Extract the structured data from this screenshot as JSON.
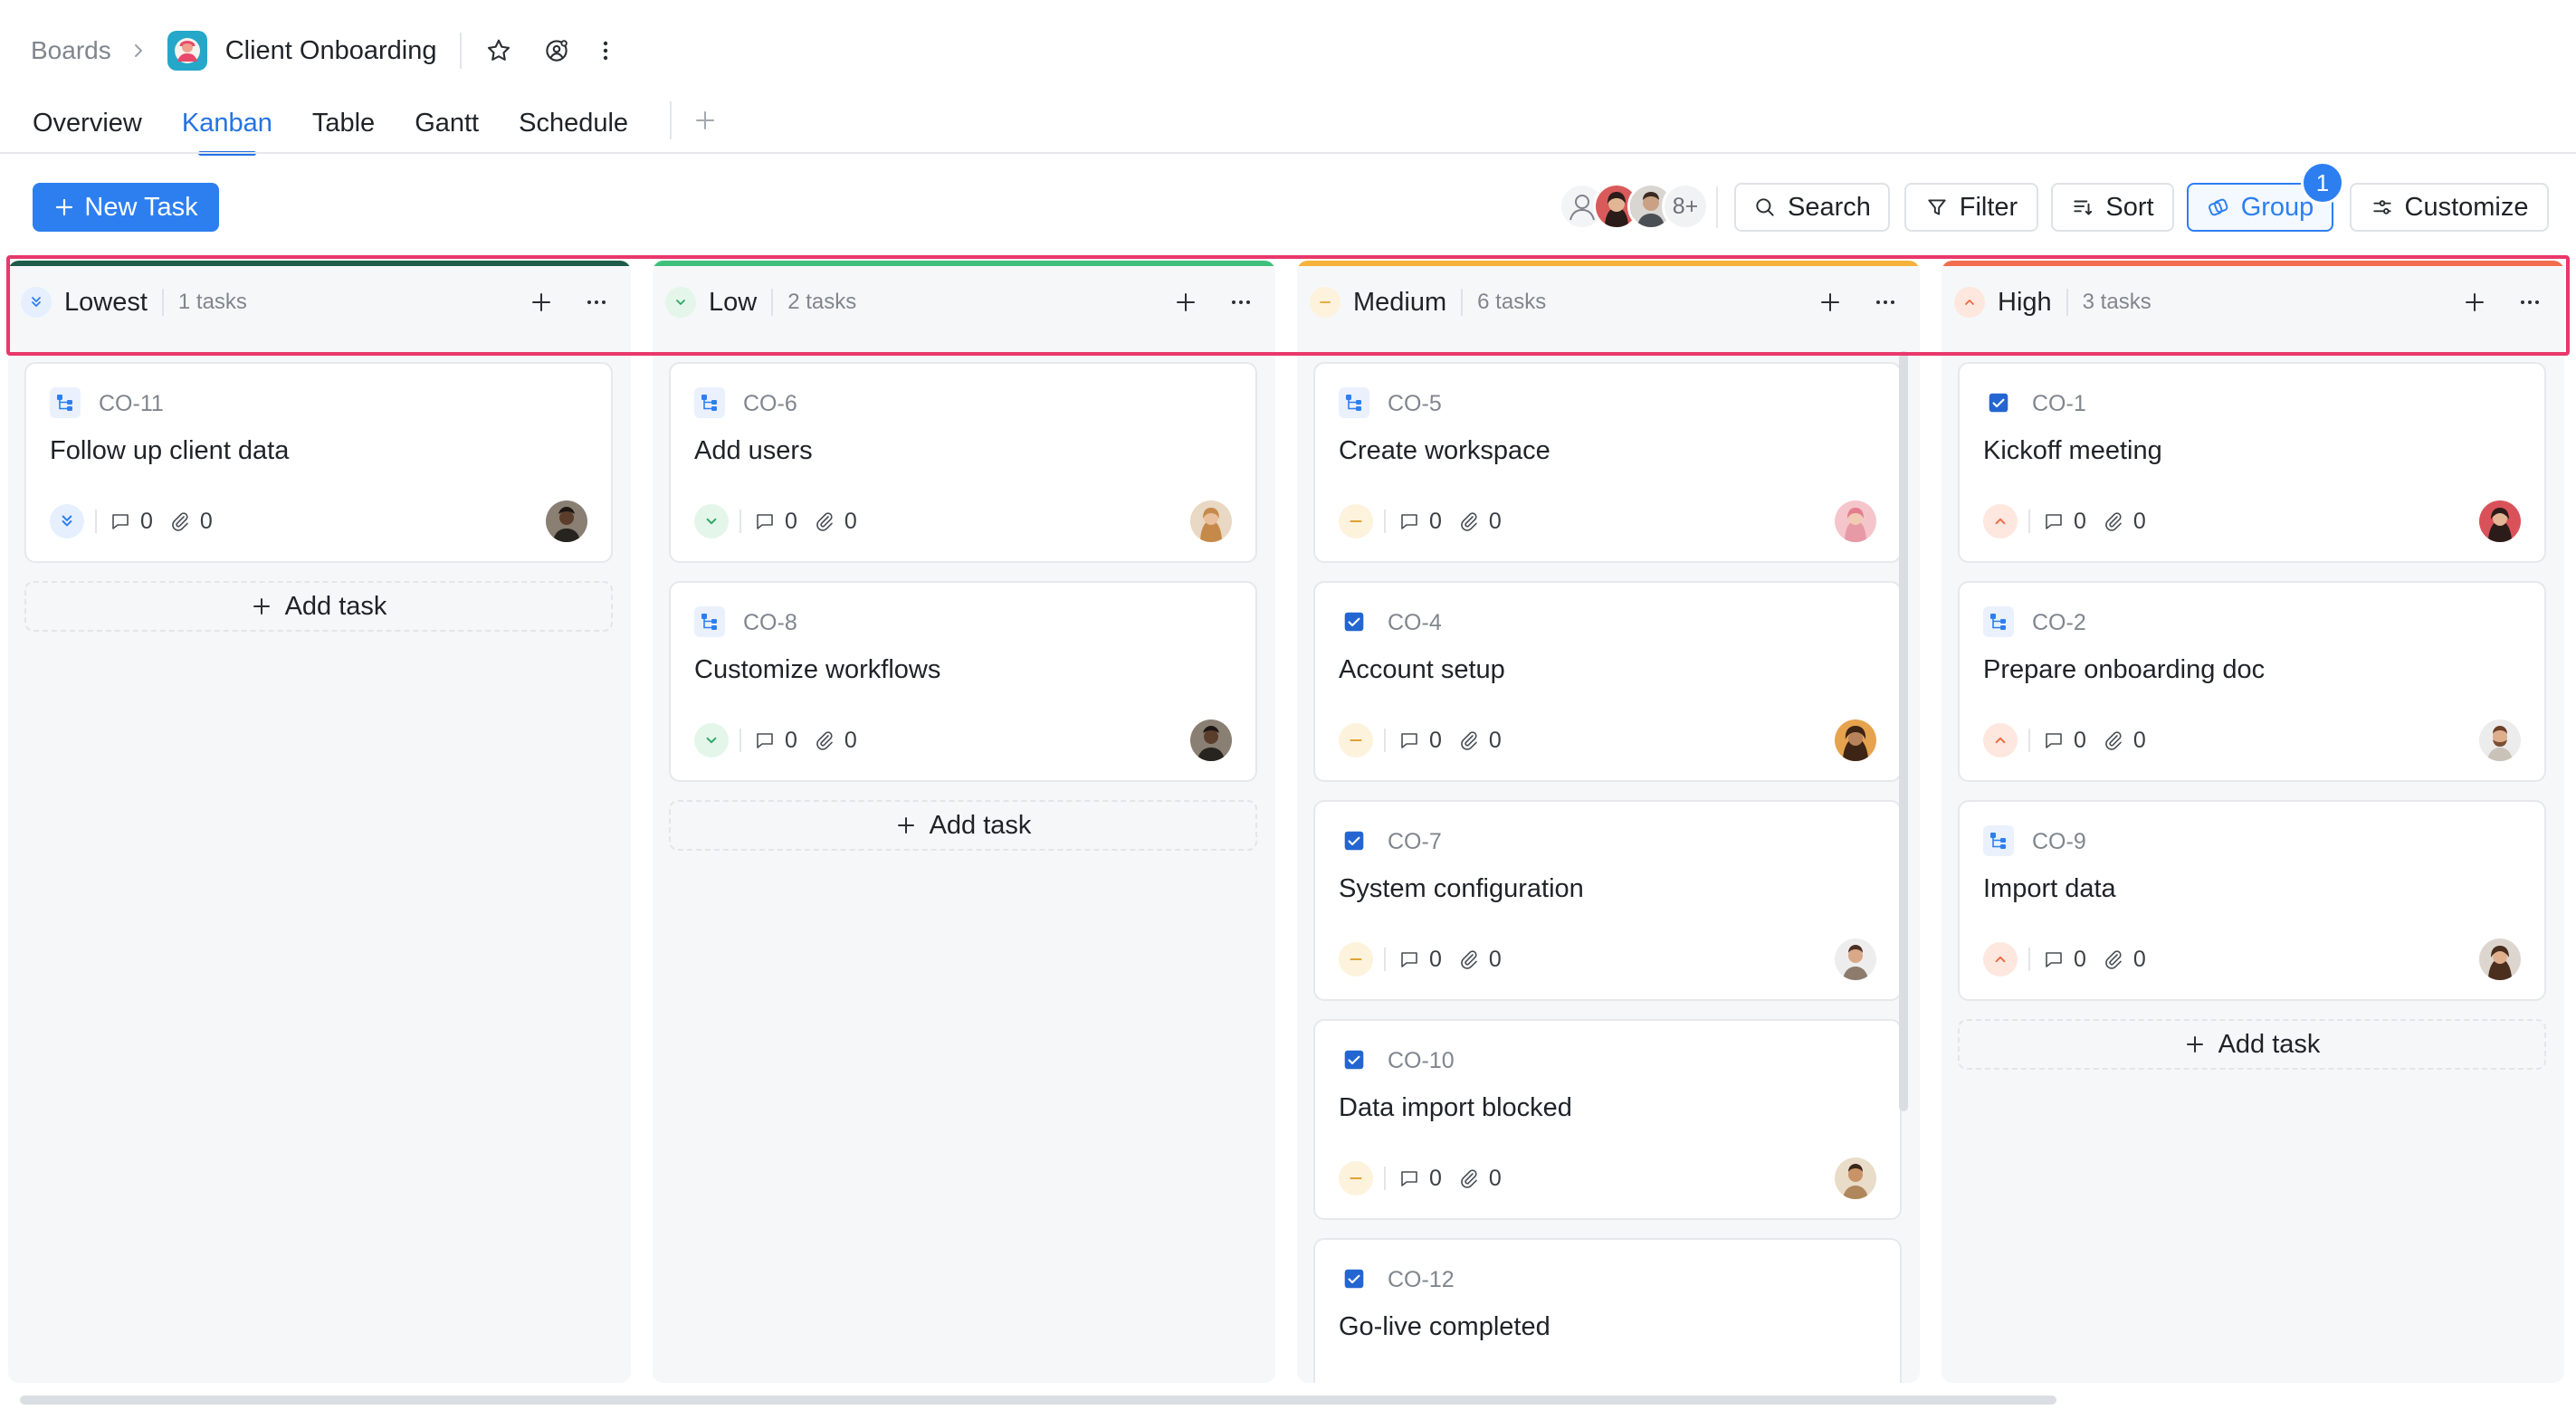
{
  "breadcrumb": {
    "root": "Boards",
    "board_title": "Client Onboarding"
  },
  "tabs": [
    {
      "label": "Overview"
    },
    {
      "label": "Kanban",
      "active": true
    },
    {
      "label": "Table"
    },
    {
      "label": "Gantt"
    },
    {
      "label": "Schedule"
    }
  ],
  "toolbar": {
    "new_task_label": "New Task",
    "members_more": "8+",
    "search_label": "Search",
    "filter_label": "Filter",
    "sort_label": "Sort",
    "group_label": "Group",
    "group_badge": "1",
    "customize_label": "Customize"
  },
  "colors": {
    "accent": "#2d7ff0",
    "lowest": "#1e5b4a",
    "low": "#3fc07a",
    "medium": "#f6b23a",
    "high": "#f26d4f",
    "highlight": "#e8386b"
  },
  "columns": [
    {
      "name": "Lowest",
      "count": "1 tasks",
      "priority_icon": "double-chevron-down-icon",
      "cards": [
        {
          "key": "CO-11",
          "title": "Follow up client data",
          "type": "subtask-icon",
          "comments": "0",
          "attachments": "0",
          "assignee": "avatar-man-dark"
        }
      ],
      "add_label": "Add task"
    },
    {
      "name": "Low",
      "count": "2 tasks",
      "priority_icon": "chevron-down-icon",
      "cards": [
        {
          "key": "CO-6",
          "title": "Add users",
          "type": "subtask-icon",
          "comments": "0",
          "attachments": "0",
          "assignee": "avatar-woman-blonde"
        },
        {
          "key": "CO-8",
          "title": "Customize workflows",
          "type": "subtask-icon",
          "comments": "0",
          "attachments": "0",
          "assignee": "avatar-man-dark"
        }
      ],
      "add_label": "Add task"
    },
    {
      "name": "Medium",
      "count": "6 tasks",
      "priority_icon": "minus-icon",
      "cards": [
        {
          "key": "CO-5",
          "title": "Create workspace",
          "type": "subtask-icon",
          "comments": "0",
          "attachments": "0",
          "assignee": "avatar-woman-pink"
        },
        {
          "key": "CO-4",
          "title": "Account setup",
          "type": "checkbox-icon",
          "comments": "0",
          "attachments": "0",
          "assignee": "avatar-woman-curly"
        },
        {
          "key": "CO-7",
          "title": "System configuration",
          "type": "checkbox-icon",
          "comments": "0",
          "attachments": "0",
          "assignee": "avatar-man-light"
        },
        {
          "key": "CO-10",
          "title": "Data import blocked",
          "type": "checkbox-icon",
          "comments": "0",
          "attachments": "0",
          "assignee": "avatar-man-tan"
        },
        {
          "key": "CO-12",
          "title": "Go-live completed",
          "type": "checkbox-icon",
          "comments": "",
          "attachments": "",
          "assignee": ""
        }
      ],
      "add_label": ""
    },
    {
      "name": "High",
      "count": "3 tasks",
      "priority_icon": "chevron-up-icon",
      "cards": [
        {
          "key": "CO-1",
          "title": "Kickoff meeting",
          "type": "checkbox-icon",
          "comments": "0",
          "attachments": "0",
          "assignee": "avatar-woman-red"
        },
        {
          "key": "CO-2",
          "title": "Prepare onboarding doc",
          "type": "subtask-icon",
          "comments": "0",
          "attachments": "0",
          "assignee": "avatar-man-beard"
        },
        {
          "key": "CO-9",
          "title": "Import data",
          "type": "subtask-icon",
          "comments": "0",
          "attachments": "0",
          "assignee": "avatar-woman-brown"
        }
      ],
      "add_label": "Add task"
    }
  ]
}
